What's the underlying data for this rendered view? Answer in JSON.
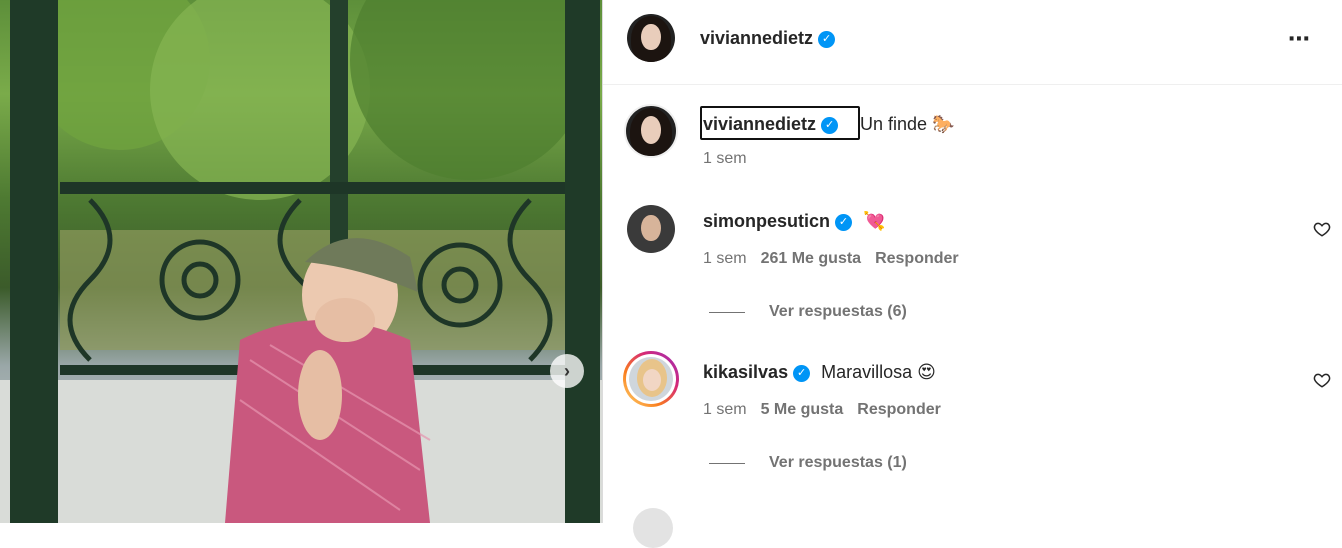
{
  "post": {
    "username": "viviannedietz",
    "caption_username": "viviannedietz",
    "caption_text": "Un finde 🐎",
    "caption_time": "1 sem",
    "more_icon": "⋯"
  },
  "comments": [
    {
      "username": "simonpesuticn",
      "text": "💘",
      "time": "1 sem",
      "likes": "261 Me gusta",
      "reply": "Responder",
      "view_replies": "Ver respuestas (6)"
    },
    {
      "username": "kikasilvas",
      "text": "Maravillosa 😍",
      "time": "1 sem",
      "likes": "5 Me gusta",
      "reply": "Responder",
      "view_replies": "Ver respuestas (1)"
    }
  ],
  "colors": {
    "verified": "#0095f6",
    "muted": "#737373",
    "text": "#262626"
  },
  "icons": {
    "verified": "✓",
    "next": "›",
    "heart": "heart-outline"
  }
}
